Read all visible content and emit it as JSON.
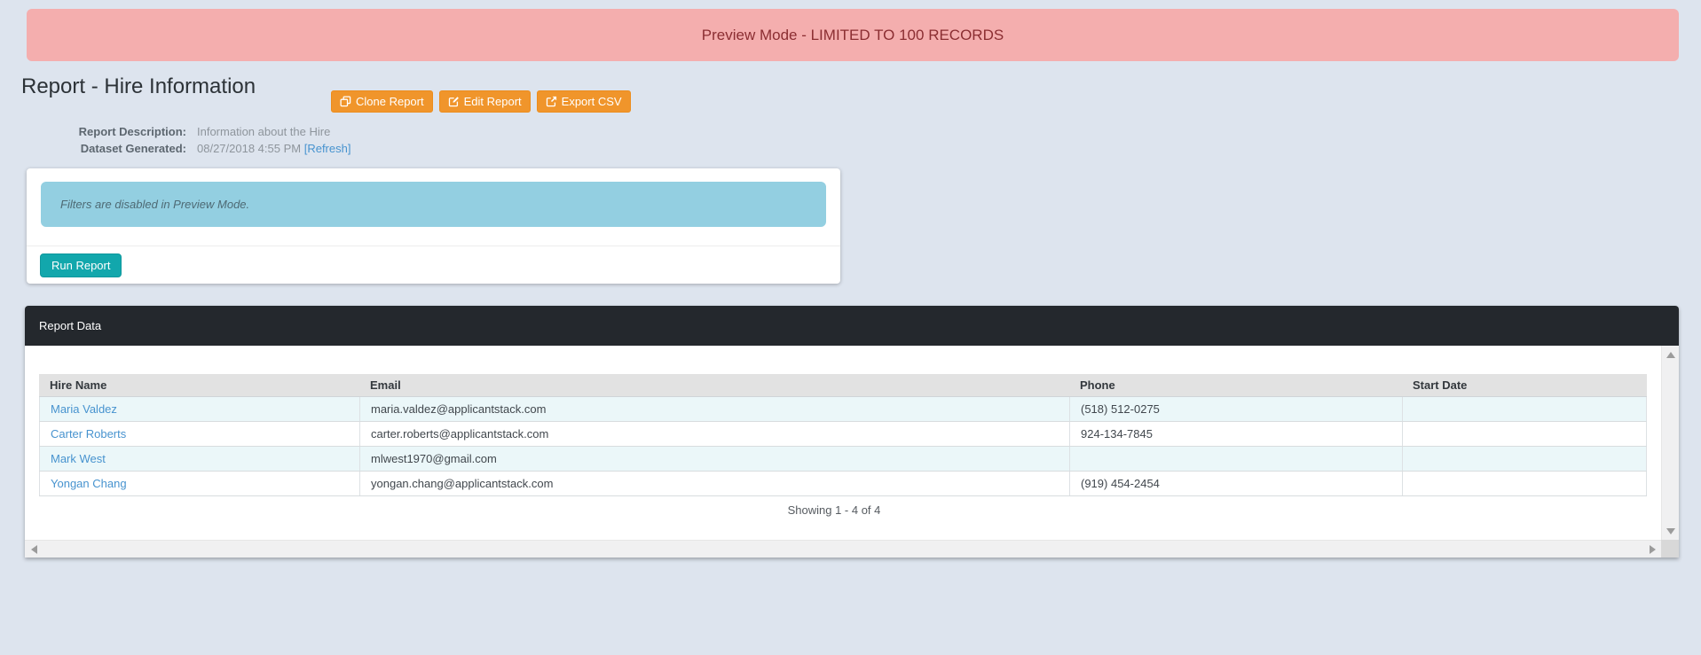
{
  "banner": {
    "text": "Preview Mode - LIMITED TO 100 RECORDS"
  },
  "header": {
    "title": "Report - Hire Information",
    "buttons": [
      {
        "label": "Clone Report",
        "icon": "clone-icon"
      },
      {
        "label": "Edit Report",
        "icon": "edit-icon"
      },
      {
        "label": "Export CSV",
        "icon": "export-icon"
      }
    ],
    "meta": {
      "description_label": "Report Description:",
      "description_value": "Information about the Hire",
      "generated_label": "Dataset Generated:",
      "generated_value": "08/27/2018 4:55 PM",
      "refresh_link": "[Refresh]"
    }
  },
  "filters_card": {
    "notice": "Filters are disabled in Preview Mode.",
    "run_button": "Run Report"
  },
  "report_data": {
    "panel_title": "Report Data",
    "table": {
      "columns": [
        "Hire Name",
        "Email",
        "Phone",
        "Start Date"
      ],
      "rows": [
        {
          "hire_name": "Maria Valdez",
          "email": "maria.valdez@applicantstack.com",
          "phone": "(518) 512-0275",
          "start_date": ""
        },
        {
          "hire_name": "Carter Roberts",
          "email": "carter.roberts@applicantstack.com",
          "phone": "924-134-7845",
          "start_date": ""
        },
        {
          "hire_name": "Mark West",
          "email": "mlwest1970@gmail.com",
          "phone": "",
          "start_date": ""
        },
        {
          "hire_name": "Yongan Chang",
          "email": "yongan.chang@applicantstack.com",
          "phone": "(919) 454-2454",
          "start_date": ""
        }
      ]
    },
    "pagination": "Showing 1 - 4 of 4"
  },
  "colors": {
    "page_background": "#dde4ee",
    "banner_background": "#f4aeae",
    "banner_text": "#8b2e32",
    "accent_orange": "#f0952b",
    "accent_teal": "#12a7ac",
    "notice_blue": "#93cfe1",
    "panel_header_dark": "#24282d",
    "link_blue": "#4793cf",
    "row_stripe": "#ebf7f9"
  }
}
